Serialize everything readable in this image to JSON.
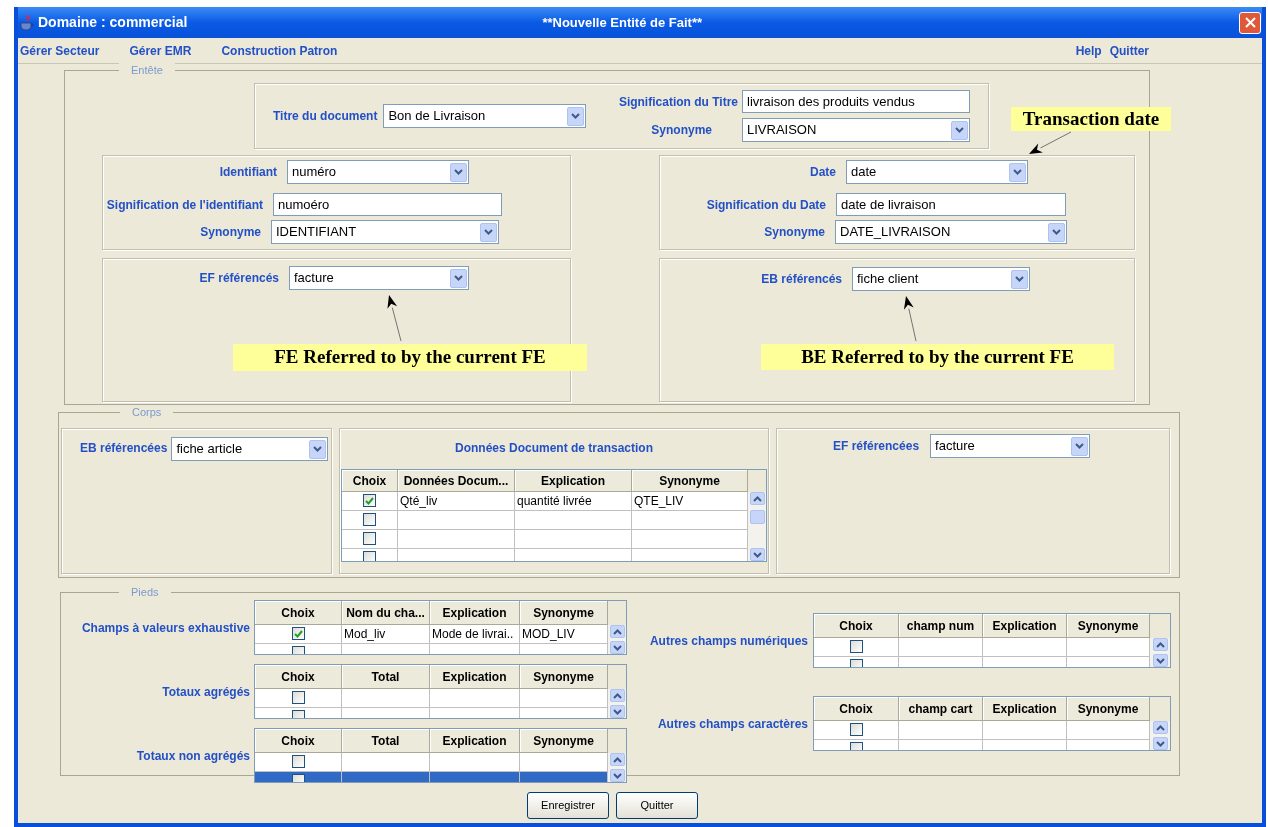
{
  "window": {
    "title": "Domaine : commercial",
    "caption": "**Nouvelle Entité de Fait**"
  },
  "menu": {
    "left": [
      "Gérer Secteur",
      "Gérer EMR",
      "Construction Patron"
    ],
    "right": [
      "Help",
      "Quitter"
    ]
  },
  "entete": {
    "legend": "Entête",
    "document": {
      "fields": [
        {
          "kind": "combo",
          "label": "Titre du document",
          "value": "Bon de Livraison"
        },
        {
          "kind": "text",
          "label": "Signification du Titre",
          "value": "livraison des produits vendus"
        },
        {
          "kind": "combo",
          "label": "Synonyme",
          "value": "LIVRAISON"
        }
      ]
    },
    "identifiant": {
      "fields": [
        {
          "kind": "combo",
          "label": "Identifiant",
          "value": "numéro"
        },
        {
          "kind": "text",
          "label": "Signification de l'identifiant",
          "value": "numoéro"
        },
        {
          "kind": "combo",
          "label": "Synonyme",
          "value": "IDENTIFIANT"
        }
      ]
    },
    "date": {
      "annotation": "Transaction date",
      "fields": [
        {
          "kind": "combo",
          "label": "Date",
          "value": "date"
        },
        {
          "kind": "text",
          "label": "Signification du Date",
          "value": "date de livraison"
        },
        {
          "kind": "combo",
          "label": "Synonyme",
          "value": "DATE_LIVRAISON"
        }
      ]
    },
    "ef": {
      "annotation": "FE Referred to by the current FE",
      "fields": [
        {
          "kind": "combo",
          "label": "EF référencés",
          "value": "facture"
        }
      ]
    },
    "eb": {
      "annotation": "BE Referred to by the current FE",
      "fields": [
        {
          "kind": "combo",
          "label": "EB référencés",
          "value": "fiche client"
        }
      ]
    }
  },
  "corps": {
    "legend": "Corps",
    "eb": {
      "label": "EB référencées",
      "value": "fiche article"
    },
    "donnees": {
      "title": "Données Document de transaction",
      "table": {
        "columns": [
          "Choix",
          "Données Docum...",
          "Explication",
          "Synonyme"
        ],
        "rows": [
          {
            "checked": true,
            "selected": false,
            "cells": [
              "Qté_liv",
              "quantité livrée",
              "QTE_LIV"
            ]
          },
          {
            "checked": false,
            "selected": false
          },
          {
            "checked": false,
            "selected": false
          },
          {
            "checked": false,
            "selected": false
          }
        ]
      }
    },
    "ef": {
      "label": "EF référencées",
      "value": "facture"
    }
  },
  "pieds": {
    "legend": "Pieds",
    "left_tables": [
      {
        "label": "Champs à valeurs exhaustive",
        "columns": [
          "Choix",
          "Nom du cha...",
          "Explication",
          "Synonyme"
        ],
        "rows": [
          {
            "checked": true,
            "selected": false,
            "cells": [
              "Mod_liv",
              "Mode de livrai..",
              "MOD_LIV"
            ]
          },
          {
            "selected": false
          }
        ]
      },
      {
        "label": "Totaux agrégés",
        "columns": [
          "Choix",
          "Total",
          "Explication",
          "Synonyme"
        ],
        "rows": [
          {
            "checked": false,
            "selected": false
          },
          {
            "selected": false
          }
        ]
      },
      {
        "label": "Totaux non agrégés",
        "columns": [
          "Choix",
          "Total",
          "Explication",
          "Synonyme"
        ],
        "rows": [
          {
            "checked": false,
            "selected": false
          },
          {
            "selected": true
          }
        ]
      }
    ],
    "right_tables": [
      {
        "label": "Autres champs numériques",
        "columns": [
          "Choix",
          "champ num",
          "Explication",
          "Synonyme"
        ],
        "rows": [
          {
            "checked": false,
            "selected": false
          },
          {
            "selected": false
          }
        ]
      },
      {
        "label": "Autres champs caractères",
        "columns": [
          "Choix",
          "champ cart",
          "Explication",
          "Synonyme"
        ],
        "rows": [
          {
            "checked": false,
            "selected": false
          },
          {
            "selected": false
          }
        ]
      }
    ]
  },
  "buttons": [
    "Enregistrer",
    "Quitter"
  ]
}
